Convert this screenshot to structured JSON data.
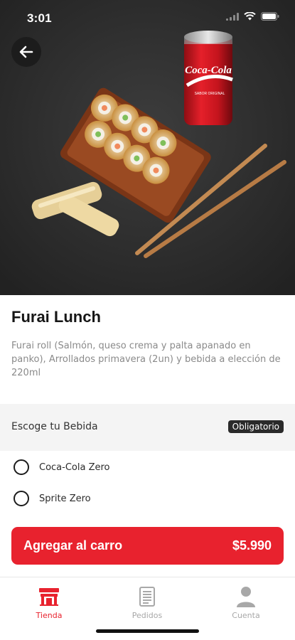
{
  "status_bar": {
    "time": "3:01",
    "icons": [
      "signal-icon",
      "wifi-icon",
      "battery-icon"
    ]
  },
  "header": {
    "back_icon": "arrow-left-icon"
  },
  "hero": {
    "can_brand": "Coca-Cola",
    "can_subtext": "SABOR ORIGINAL"
  },
  "product": {
    "title": "Furai Lunch",
    "description": "Furai roll (Salmón, queso crema y palta apanado en panko), Arrollados primavera (2un) y bebida a elección de 220ml"
  },
  "options": {
    "group_title": "Escoge tu Bebida",
    "required_label": "Obligatorio",
    "items": [
      {
        "label": "Coca-Cola Zero",
        "selected": false
      },
      {
        "label": "Sprite Zero",
        "selected": false
      }
    ]
  },
  "cart_button": {
    "label": "Agregar al carro",
    "price": "$5.990"
  },
  "tabs": [
    {
      "label": "Tienda",
      "icon": "store-icon",
      "active": true
    },
    {
      "label": "Pedidos",
      "icon": "receipt-icon",
      "active": false
    },
    {
      "label": "Cuenta",
      "icon": "user-icon",
      "active": false
    }
  ],
  "colors": {
    "accent": "#e8222e",
    "text": "#161616",
    "muted": "#8a8a8a",
    "inactive_tab": "#a8a8a8"
  }
}
